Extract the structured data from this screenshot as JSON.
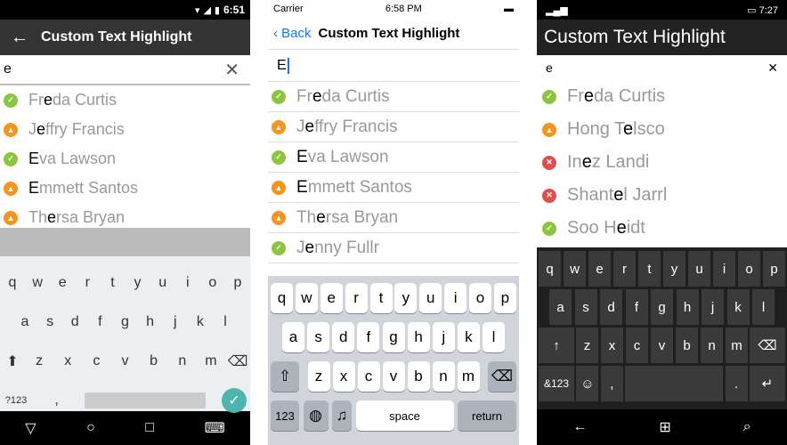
{
  "android": {
    "time": "6:51",
    "title": "Custom Text Highlight",
    "search_value": "e",
    "items": [
      {
        "pre": "Fr",
        "hl": "e",
        "post": "da Curtis",
        "status": "ok"
      },
      {
        "pre": "J",
        "hl": "e",
        "post": "ffry Francis",
        "status": "warn"
      },
      {
        "pre": "",
        "hl": "E",
        "post": "va Lawson",
        "status": "ok"
      },
      {
        "pre": "",
        "hl": "E",
        "post": "mmett Santos",
        "status": "warn"
      },
      {
        "pre": "Th",
        "hl": "e",
        "post": "rsa Bryan",
        "status": "warn"
      }
    ],
    "kb_row1": [
      "q",
      "w",
      "e",
      "r",
      "t",
      "y",
      "u",
      "i",
      "o",
      "p"
    ],
    "kb_row2": [
      "a",
      "s",
      "d",
      "f",
      "g",
      "h",
      "j",
      "k",
      "l"
    ],
    "kb_row3": [
      "z",
      "x",
      "c",
      "v",
      "b",
      "n",
      "m"
    ],
    "sym": "?123",
    "comma": ","
  },
  "ios": {
    "carrier": "Carrier",
    "time": "6:58 PM",
    "back": "Back",
    "title": "Custom Text Highlight",
    "search_value": "E",
    "items": [
      {
        "pre": "Fr",
        "hl": "e",
        "post": "da Curtis",
        "status": "ok"
      },
      {
        "pre": "J",
        "hl": "e",
        "post": "ffry Francis",
        "status": "warn"
      },
      {
        "pre": "",
        "hl": "E",
        "post": "va Lawson",
        "status": "ok"
      },
      {
        "pre": "",
        "hl": "E",
        "post": "mmett Santos",
        "status": "warn"
      },
      {
        "pre": "Th",
        "hl": "e",
        "post": "rsa Bryan",
        "status": "warn"
      },
      {
        "pre": "J",
        "hl": "e",
        "post": "nny Fullr",
        "status": "ok"
      }
    ],
    "kb_row1": [
      "q",
      "w",
      "e",
      "r",
      "t",
      "y",
      "u",
      "i",
      "o",
      "p"
    ],
    "kb_row2": [
      "a",
      "s",
      "d",
      "f",
      "g",
      "h",
      "j",
      "k",
      "l"
    ],
    "kb_row3": [
      "z",
      "x",
      "c",
      "v",
      "b",
      "n",
      "m"
    ],
    "num": "123",
    "space": "space",
    "return": "return"
  },
  "win": {
    "time": "7:27",
    "title": "Custom Text Highlight",
    "search_value": "e",
    "items": [
      {
        "pre": "Fr",
        "hl": "e",
        "post": "da Curtis",
        "status": "ok"
      },
      {
        "pre": "Hong T",
        "hl": "e",
        "post": "lsco",
        "status": "warn"
      },
      {
        "pre": "In",
        "hl": "e",
        "post": "z Landi",
        "status": "err"
      },
      {
        "pre": "Shant",
        "hl": "e",
        "post": "l Jarrl",
        "status": "err"
      },
      {
        "pre": "Soo H",
        "hl": "e",
        "post": "idt",
        "status": "ok"
      }
    ],
    "kb_row1": [
      "q",
      "w",
      "e",
      "r",
      "t",
      "y",
      "u",
      "i",
      "o",
      "p"
    ],
    "kb_row2": [
      "a",
      "s",
      "d",
      "f",
      "g",
      "h",
      "j",
      "k",
      "l"
    ],
    "kb_row3": [
      "z",
      "x",
      "c",
      "v",
      "b",
      "n",
      "m"
    ],
    "sym": "&123"
  }
}
